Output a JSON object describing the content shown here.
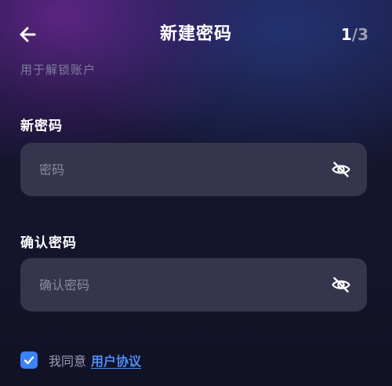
{
  "header": {
    "back_icon": "arrow-left-icon",
    "title": "新建密码",
    "step_current": "1",
    "step_total": "/3"
  },
  "subtitle": "用于解锁账户",
  "new_password": {
    "label": "新密码",
    "placeholder": "密码",
    "value": "",
    "toggle_icon": "eye-off-icon"
  },
  "confirm_password": {
    "label": "确认密码",
    "placeholder": "确认密码",
    "value": "",
    "toggle_icon": "eye-off-icon"
  },
  "agreement": {
    "checked": true,
    "text": "我同意",
    "link": "用户协议",
    "checkbox_color": "#3b82f6",
    "link_color": "#4a8ef7"
  }
}
